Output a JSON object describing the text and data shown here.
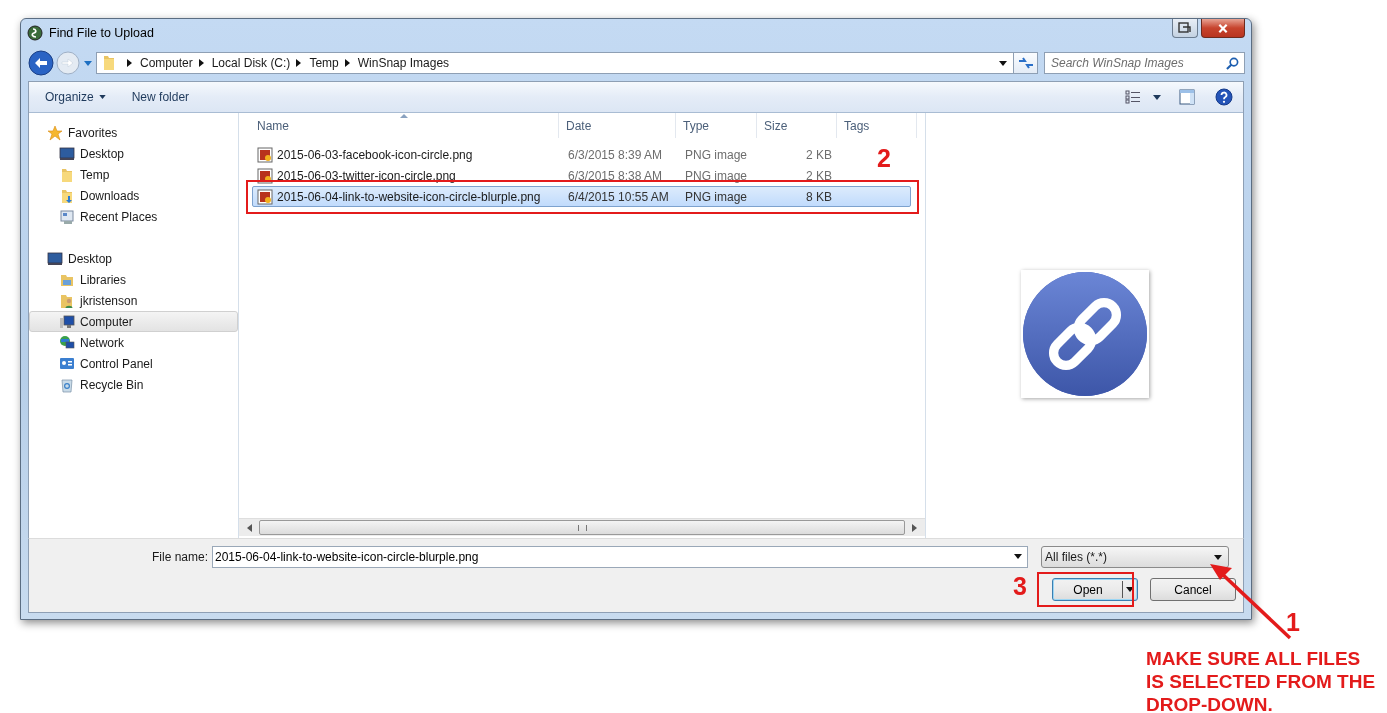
{
  "window": {
    "title": "Find File to Upload"
  },
  "address": {
    "crumbs": [
      "Computer",
      "Local Disk (C:)",
      "Temp",
      "WinSnap Images"
    ],
    "search_placeholder": "Search WinSnap Images"
  },
  "toolbar": {
    "items": [
      {
        "label": "Organize",
        "kind": "menu"
      },
      {
        "label": "New folder",
        "kind": "button"
      }
    ]
  },
  "sidebar": {
    "groups": [
      {
        "label": "Favorites",
        "kind": "star",
        "selected": false,
        "children": [
          {
            "label": "Desktop",
            "kind": "desktop",
            "selected": false
          },
          {
            "label": "Temp",
            "kind": "folder",
            "selected": false
          },
          {
            "label": "Downloads",
            "kind": "downloads",
            "selected": false
          },
          {
            "label": "Recent Places",
            "kind": "recent",
            "selected": false
          }
        ]
      },
      {
        "label": "Desktop",
        "kind": "desktop",
        "selected": false,
        "children": [
          {
            "label": "Libraries",
            "kind": "libraries",
            "selected": false
          },
          {
            "label": "jkristenson",
            "kind": "user",
            "selected": false
          },
          {
            "label": "Computer",
            "kind": "computer",
            "selected": true
          },
          {
            "label": "Network",
            "kind": "network",
            "selected": false
          },
          {
            "label": "Control Panel",
            "kind": "control",
            "selected": false
          },
          {
            "label": "Recycle Bin",
            "kind": "recycle",
            "selected": false
          }
        ]
      }
    ]
  },
  "table": {
    "columns": [
      {
        "label": "Name",
        "sorted": true
      },
      {
        "label": "Date",
        "sorted": false
      },
      {
        "label": "Type",
        "sorted": false
      },
      {
        "label": "Size",
        "sorted": false
      },
      {
        "label": "Tags",
        "sorted": false
      }
    ],
    "rows": [
      {
        "name": "2015-06-03-facebook-icon-circle.png",
        "date": "6/3/2015 8:39 AM",
        "type": "PNG image",
        "size": "2 KB",
        "selected": false
      },
      {
        "name": "2015-06-03-twitter-icon-circle.png",
        "date": "6/3/2015 8:38 AM",
        "type": "PNG image",
        "size": "2 KB",
        "selected": false
      },
      {
        "name": "2015-06-04-link-to-website-icon-circle-blurple.png",
        "date": "6/4/2015 10:55 AM",
        "type": "PNG image",
        "size": "8 KB",
        "selected": true
      }
    ]
  },
  "footer": {
    "file_name_label": "File name:",
    "file_name": "2015-06-04-link-to-website-icon-circle-blurple.png",
    "filter": "All files (*.*)",
    "buttons": [
      {
        "label": "Open",
        "kind": "split",
        "default": true
      },
      {
        "label": "Cancel",
        "kind": "plain",
        "default": false
      }
    ]
  },
  "annotations": [
    {
      "kind": "step",
      "label": "2"
    },
    {
      "kind": "step",
      "label": "3"
    },
    {
      "kind": "step",
      "label": "1"
    },
    {
      "kind": "note",
      "label": "MAKE SURE ALL FILES IS SELECTED FROM THE DROP-DOWN."
    }
  ]
}
